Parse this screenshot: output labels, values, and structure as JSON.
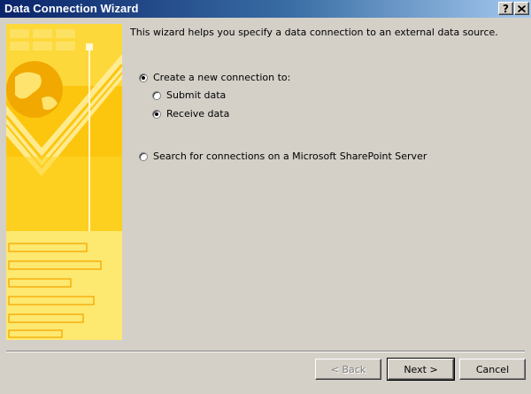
{
  "window": {
    "title": "Data Connection Wizard"
  },
  "titlebar_buttons": {
    "help": "?",
    "close": "X"
  },
  "intro": "This wizard helps you specify a data connection to an external data source.",
  "options": {
    "create_new": {
      "label": "Create a new connection to:",
      "selected": true
    },
    "submit_data": {
      "label": "Submit data",
      "selected": false
    },
    "receive_data": {
      "label": "Receive data",
      "selected": true
    },
    "search_sharepoint": {
      "label": "Search for connections on a Microsoft SharePoint Server",
      "selected": false
    }
  },
  "buttons": {
    "back": "< Back",
    "next": "Next >",
    "cancel": "Cancel"
  },
  "colors": {
    "title_start": "#0a246a",
    "title_end": "#a6caf0",
    "face": "#d4d0c8",
    "art_yellow": "#fcd116"
  }
}
